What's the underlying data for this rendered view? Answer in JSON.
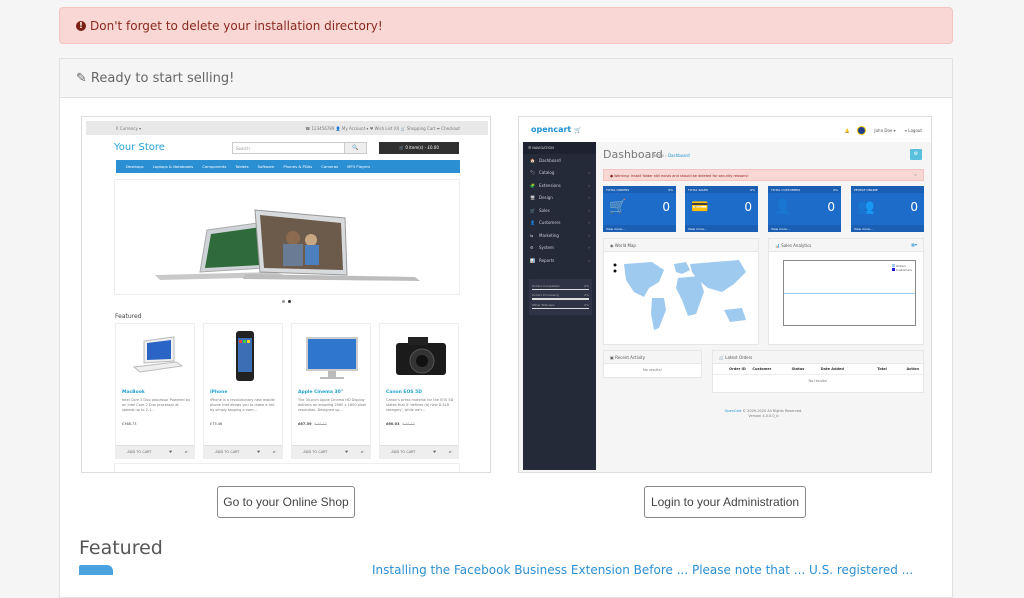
{
  "alert": {
    "icon": "exclamation-circle-icon",
    "text": "Don't forget to delete your installation directory!"
  },
  "panel": {
    "icon": "pencil-icon",
    "title": "Ready to start selling!"
  },
  "storefront": {
    "currency": "€ Currency ▾",
    "top_links": "☎ 123456789   👤 My Account ▾   ♥ Wish List (0)   🛒 Shopping Cart   ➦ Checkout",
    "logo": "Your Store",
    "search_placeholder": "Search",
    "search_icon": "🔍",
    "cart_button": "🛒 0 item(s) - £0.00",
    "menu": [
      "Desktops",
      "Laptops & Notebooks",
      "Components",
      "Tablets",
      "Software",
      "Phones & PDAs",
      "Cameras",
      "MP3 Players"
    ],
    "featured_title": "Featured",
    "products": [
      {
        "name": "MacBook",
        "desc": "Intel Core 2 Duo processor Powered by an Intel Core 2 Duo processor at speeds up to 2.1...",
        "price": "£368.73",
        "old_price": ""
      },
      {
        "name": "iPhone",
        "desc": "iPhone is a revolutionary new mobile phone that allows you to make a call by simply tapping a nam...",
        "price": "£75.46",
        "old_price": ""
      },
      {
        "name": "Apple Cinema 30\"",
        "desc": "The 30-inch Apple Cinema HD Display delivers an amazing 2560 x 1600 pixel resolution. Designed sp...",
        "price": "£67.39",
        "old_price": "£74.73"
      },
      {
        "name": "Canon EOS 5D",
        "desc": "Canon's press material for the EOS 5D states that it 'defines (a) new D-SLR category', while we'r...",
        "price": "£60.03",
        "old_price": "£74.73"
      }
    ],
    "add_to_cart": "ADD TO CART",
    "wishlist_icon": "♥",
    "compare_icon": "⇄"
  },
  "admin": {
    "logo": "opencart",
    "user": "John Doe ▾",
    "logout": "Logout",
    "nav_header": "☰ NAVIGATION",
    "nav": [
      {
        "label": "Dashboard",
        "icon": "🏠",
        "arrow": false
      },
      {
        "label": "Catalog",
        "icon": "🏷",
        "arrow": true
      },
      {
        "label": "Extensions",
        "icon": "🧩",
        "arrow": true
      },
      {
        "label": "Design",
        "icon": "🖥",
        "arrow": true
      },
      {
        "label": "Sales",
        "icon": "🛒",
        "arrow": true
      },
      {
        "label": "Customers",
        "icon": "👤",
        "arrow": true
      },
      {
        "label": "Marketing",
        "icon": "⇆",
        "arrow": true
      },
      {
        "label": "System",
        "icon": "⚙",
        "arrow": true
      },
      {
        "label": "Reports",
        "icon": "📊",
        "arrow": true
      }
    ],
    "stats": [
      {
        "label": "Orders Completed",
        "value": "0%"
      },
      {
        "label": "Orders Processing",
        "value": "0%"
      },
      {
        "label": "Other Statuses",
        "value": "0%"
      }
    ],
    "title": "Dashboard",
    "breadcrumb_home": "Home",
    "breadcrumb_current": "Dashboard",
    "warning": "Warning: Install folder still exists and should be deleted for security reasons!",
    "tiles": [
      {
        "title": "TOTAL ORDERS",
        "pct": "0%",
        "value": "0",
        "icon": "🛒",
        "link": "View more..."
      },
      {
        "title": "TOTAL SALES",
        "pct": "0%",
        "value": "0",
        "icon": "💳",
        "link": "View more..."
      },
      {
        "title": "TOTAL CUSTOMERS",
        "pct": "0%",
        "value": "0",
        "icon": "👤",
        "link": "View more..."
      },
      {
        "title": "PEOPLE ONLINE",
        "pct": "",
        "value": "0",
        "icon": "👥",
        "link": "View more..."
      }
    ],
    "world_map": "World Map",
    "sales_analytics": "Sales Analytics",
    "legend": [
      "Orders",
      "Customers"
    ],
    "recent_activity": "Recent Activity",
    "latest_orders": "Latest Orders",
    "order_cols": [
      "Order ID",
      "Customer",
      "Status",
      "Date Added",
      "Total",
      "Action"
    ],
    "no_results": "No results!",
    "footer_brand": "OpenCart",
    "footer_text": "© 2009-2020 All Rights Reserved.",
    "version": "Version 4.0.0.0_b"
  },
  "buttons": {
    "shop": "Go to your Online Shop",
    "admin": "Login to your Administration"
  },
  "featured": {
    "title": "Featured",
    "text": "Installing the Facebook Business Extension Before ... Please note that ... U.S. registered ..."
  }
}
